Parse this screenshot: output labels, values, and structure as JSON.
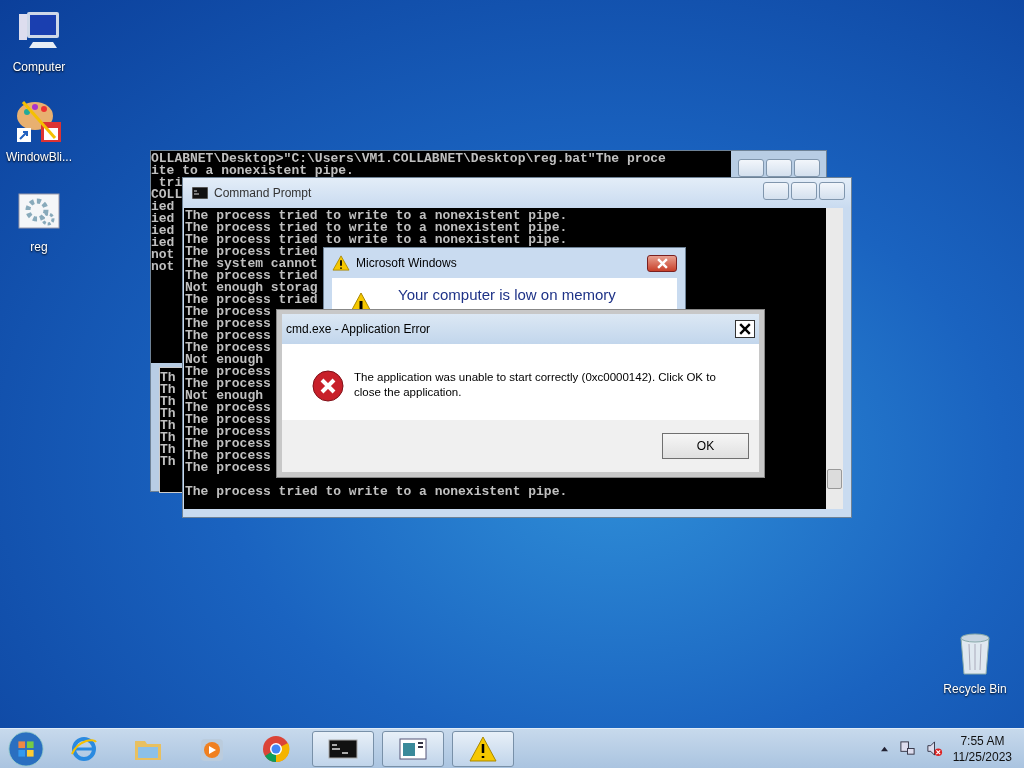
{
  "desktop_icons": [
    {
      "kind": "computer",
      "label": "Computer"
    },
    {
      "kind": "palette",
      "label": "WindowBli..."
    },
    {
      "kind": "gear",
      "label": "reg"
    }
  ],
  "recycle_bin": {
    "label": "Recycle Bin"
  },
  "back_console": {
    "lines": [
      "OLLABNET\\Desktop>\"C:\\Users\\VM1.COLLABNET\\Desktop\\reg.bat\"The proce",
      "ite to a nonexistent pipe.",
      " tri",
      "COLL",
      "ied",
      "ied",
      "ied",
      "ied",
      "not",
      "not"
    ],
    "inner_lines": [
      "Th",
      "Th",
      "Th",
      "Th",
      "Th",
      "Th",
      "Th",
      "Th"
    ]
  },
  "command_prompt": {
    "title": "Command Prompt",
    "lines": [
      "The process tried to write to a nonexistent pipe.",
      "The process tried to write to a nonexistent pipe.",
      "The process tried to write to a nonexistent pipe.",
      "The process tried",
      "The system cannot",
      "The process tried",
      "Not enough storag",
      "The process tried",
      "The process",
      "The process",
      "The process",
      "The process",
      "Not enough",
      "The process",
      "The process",
      "Not enough",
      "The process",
      "The process",
      "The process",
      "The process",
      "The process",
      "The process"
    ],
    "last_line": "The process tried to write to a nonexistent pipe."
  },
  "memory_dialog": {
    "title": "Microsoft Windows",
    "heading": "Your computer is low on memory"
  },
  "error_dialog": {
    "title": "cmd.exe - Application Error",
    "message": "The application was unable to start correctly (0xc0000142). Click OK to close the application.",
    "button": "OK"
  },
  "taskbar": {
    "items": [
      {
        "kind": "browser",
        "running": false
      },
      {
        "kind": "folder",
        "running": false
      },
      {
        "kind": "media",
        "running": false
      },
      {
        "kind": "chrome",
        "running": false
      },
      {
        "kind": "console",
        "running": true
      },
      {
        "kind": "window",
        "running": true
      },
      {
        "kind": "warning",
        "running": true
      }
    ],
    "time": "7:55 AM",
    "date": "11/25/2023"
  }
}
